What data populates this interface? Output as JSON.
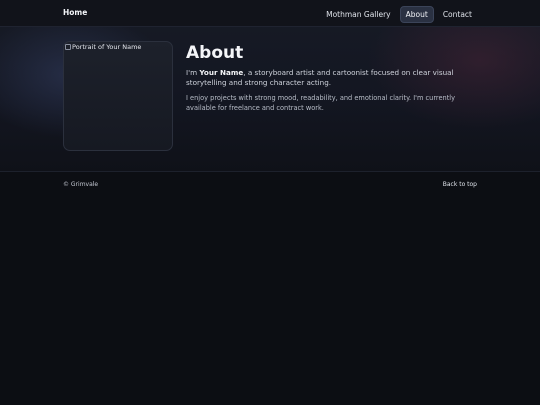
{
  "nav": {
    "brand": "Home",
    "items": [
      {
        "label": "Mothman Gallery",
        "active": false
      },
      {
        "label": "About",
        "active": true
      },
      {
        "label": "Contact",
        "active": false
      }
    ]
  },
  "main": {
    "portrait_alt": "Portrait of Your Name",
    "title": "About",
    "intro_prefix": "I'm ",
    "intro_name": "Your Name",
    "intro_suffix": ", a storyboard artist and cartoonist focused on clear visual storytelling and strong character acting.",
    "paragraph2": "I enjoy projects with strong mood, readability, and emotional clarity. I'm currently available for freelance and contract work."
  },
  "footer": {
    "copyright": "© Grimvale",
    "back_to_top": "Back to top"
  },
  "colors": {
    "background": "#0c0e13",
    "active_nav_bg": "#2a3142",
    "accent_red_glow": "#6e2d46",
    "accent_blue_glow": "#465587"
  }
}
